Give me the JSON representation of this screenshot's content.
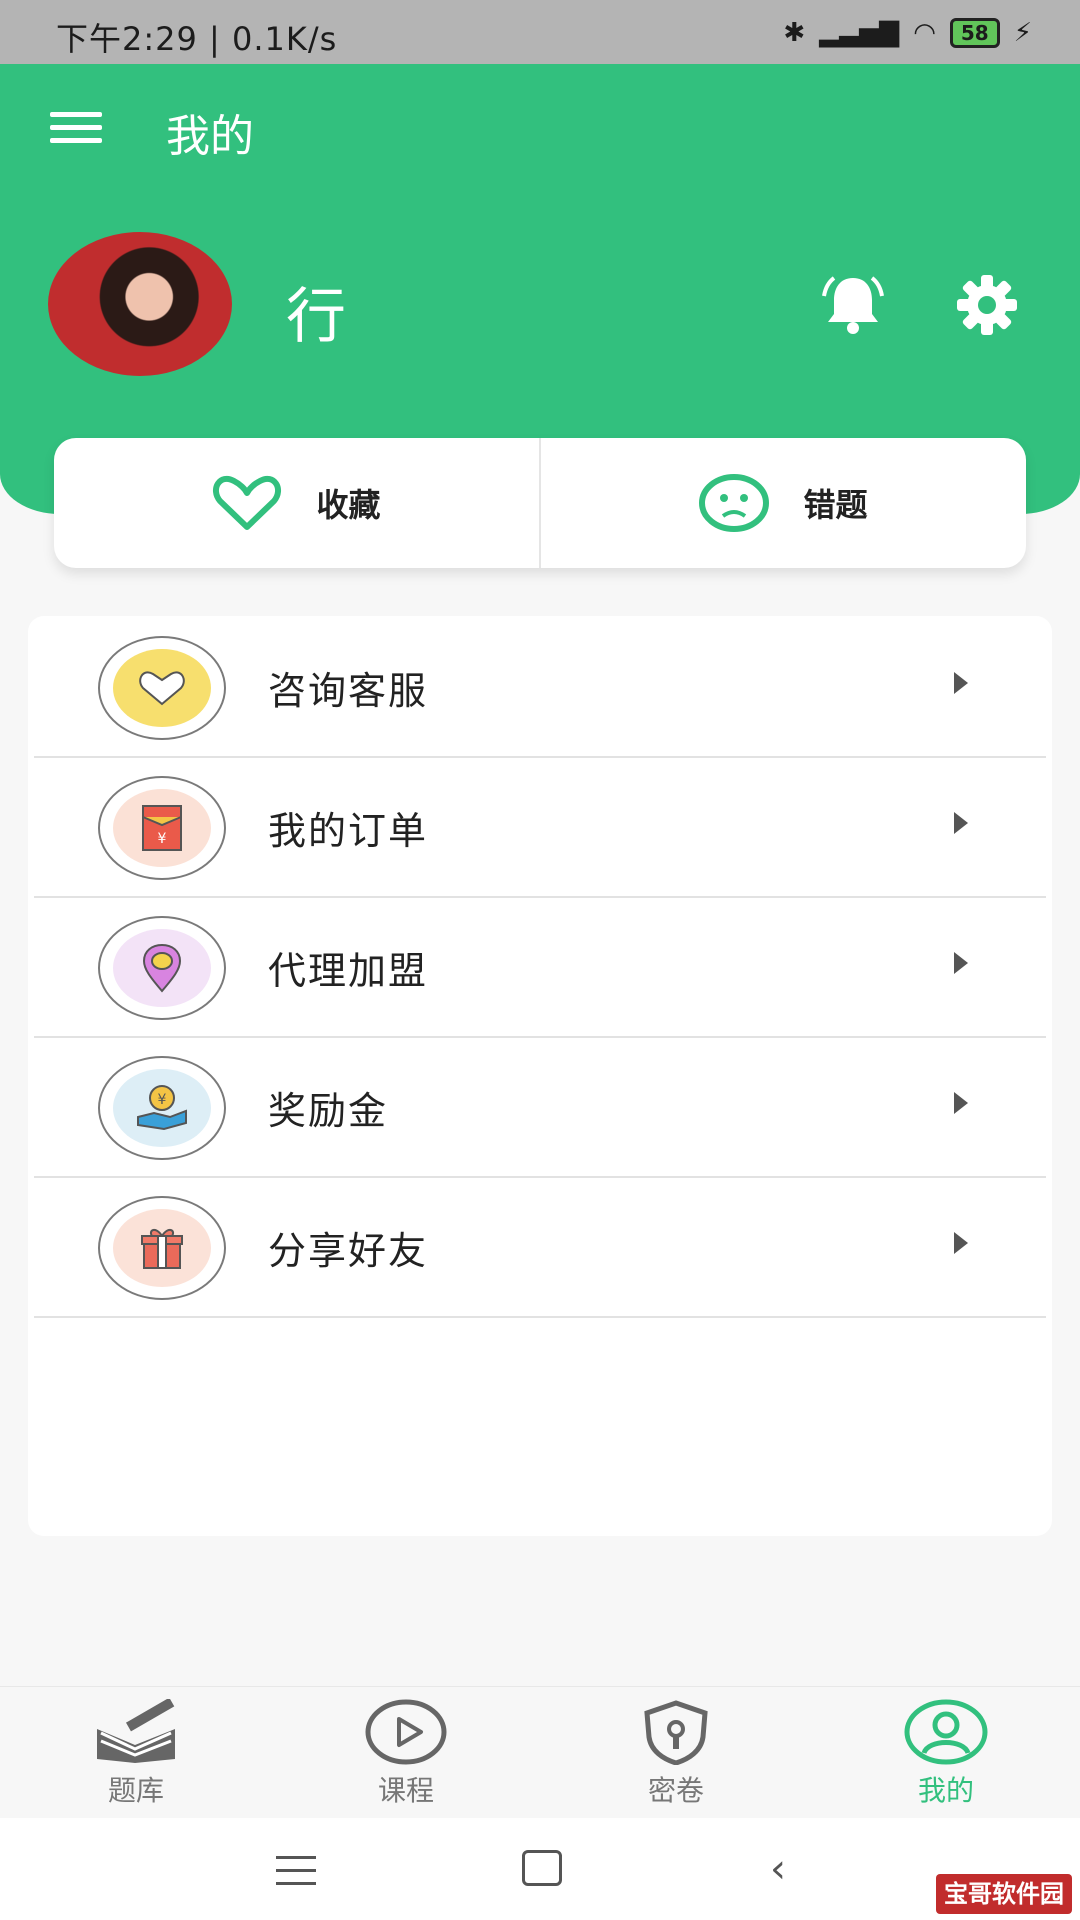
{
  "statusbar": {
    "time_speed": "下午2:29 | 0.1K/s",
    "battery": "58",
    "icons": [
      "bluetooth-icon",
      "hd-signal-icon",
      "wifi-icon",
      "battery-icon",
      "charging-icon"
    ]
  },
  "header": {
    "title": "我的",
    "username": "行",
    "icons": [
      "menu-icon",
      "bell-icon",
      "gear-icon"
    ]
  },
  "quick_actions": [
    {
      "label": "收藏",
      "icon": "heart-icon"
    },
    {
      "label": "错题",
      "icon": "sad-face-icon"
    }
  ],
  "menu": {
    "items": [
      {
        "label": "咨询客服",
        "icon": "support-heart-icon"
      },
      {
        "label": "我的订单",
        "icon": "red-envelope-icon"
      },
      {
        "label": "代理加盟",
        "icon": "location-pin-icon"
      },
      {
        "label": "奖励金",
        "icon": "coin-hand-icon"
      },
      {
        "label": "分享好友",
        "icon": "gift-icon"
      }
    ]
  },
  "bottom_nav": {
    "tabs": [
      {
        "label": "题库",
        "icon": "book-pencil-icon",
        "active": false
      },
      {
        "label": "课程",
        "icon": "play-circle-icon",
        "active": false
      },
      {
        "label": "密卷",
        "icon": "shield-lock-icon",
        "active": false
      },
      {
        "label": "我的",
        "icon": "user-circle-icon",
        "active": true
      }
    ]
  },
  "watermark": "宝哥软件园",
  "colors": {
    "brand_green": "#32c07e",
    "background": "#f7f7f7",
    "text_dark": "#222222"
  }
}
